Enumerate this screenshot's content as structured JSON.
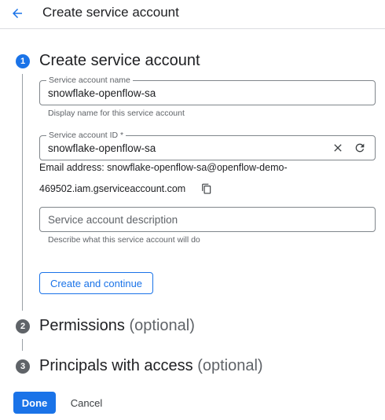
{
  "header": {
    "title": "Create service account",
    "back_icon": "arrow-back-icon"
  },
  "steps": [
    {
      "number": "1",
      "title": "Create service account",
      "optional": "",
      "state": "active"
    },
    {
      "number": "2",
      "title": "Permissions",
      "optional": "(optional)",
      "state": "inactive"
    },
    {
      "number": "3",
      "title": "Principals with access",
      "optional": "(optional)",
      "state": "inactive"
    }
  ],
  "form": {
    "name_field": {
      "label": "Service account name",
      "value": "snowflake-openflow-sa",
      "hint": "Display name for this service account"
    },
    "id_field": {
      "label": "Service account ID *",
      "value": "snowflake-openflow-sa",
      "clear_icon": "close-icon",
      "refresh_icon": "refresh-icon"
    },
    "email": {
      "line1": "Email address: snowflake-openflow-sa@openflow-demo-",
      "line2": "469502.iam.gserviceaccount.com",
      "copy_icon": "copy-icon"
    },
    "description_field": {
      "placeholder": "Service account description",
      "hint": "Describe what this service account will do"
    },
    "create_button": "Create and continue"
  },
  "footer": {
    "done": "Done",
    "cancel": "Cancel"
  },
  "colors": {
    "accent": "#1a73e8",
    "inactive_step": "#5f6368",
    "text": "#202124",
    "secondary_text": "#5f6368"
  }
}
